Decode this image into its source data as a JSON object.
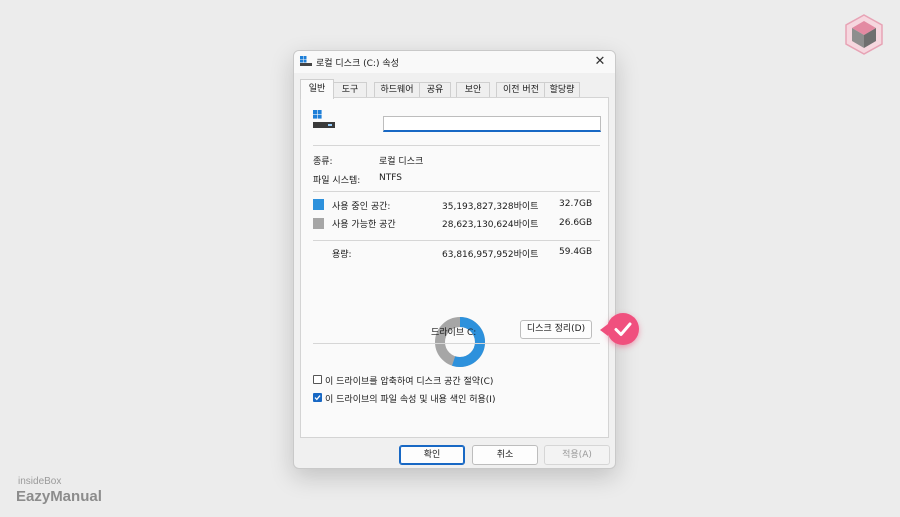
{
  "colors": {
    "used": "#2d91dc",
    "free": "#a6a6a6",
    "accent": "#1868c4",
    "highlight": "#f0507e"
  },
  "watermark": {
    "small": "insideBox",
    "big": "EazyManual"
  },
  "dialog": {
    "title": "로컬 디스크 (C:) 속성",
    "close_icon": "close-icon",
    "tabs": [
      {
        "label": "일반",
        "active": true
      },
      {
        "label": "도구"
      },
      {
        "label": "하드웨어"
      },
      {
        "label": "공유"
      },
      {
        "label": "보안"
      },
      {
        "label": "이전 버전"
      },
      {
        "label": "할당량"
      }
    ],
    "name_value": "",
    "type_label": "종류:",
    "type_value": "로컬 디스크",
    "fs_label": "파일 시스템:",
    "fs_value": "NTFS",
    "used": {
      "label": "사용 중인 공간:",
      "bytes": "35,193,827,328바이트",
      "size": "32.7GB"
    },
    "free": {
      "label": "사용 가능한 공간",
      "bytes": "28,623,130,624바이트",
      "size": "26.6GB"
    },
    "capacity": {
      "label": "용량:",
      "bytes": "63,816,957,952바이트",
      "size": "59.4GB"
    },
    "used_fraction": 0.551,
    "drive_label": "드라이브 C:",
    "cleanup_button": "디스크 정리(D)",
    "compress_checkbox": {
      "label": "이 드라이브를 압축하여 디스크 공간 절약(C)",
      "checked": false
    },
    "index_checkbox": {
      "label": "이 드라이브의 파일 속성 및 내용 색인 허용(I)",
      "checked": true
    },
    "ok_button": "확인",
    "cancel_button": "취소",
    "apply_button": "적용(A)"
  }
}
